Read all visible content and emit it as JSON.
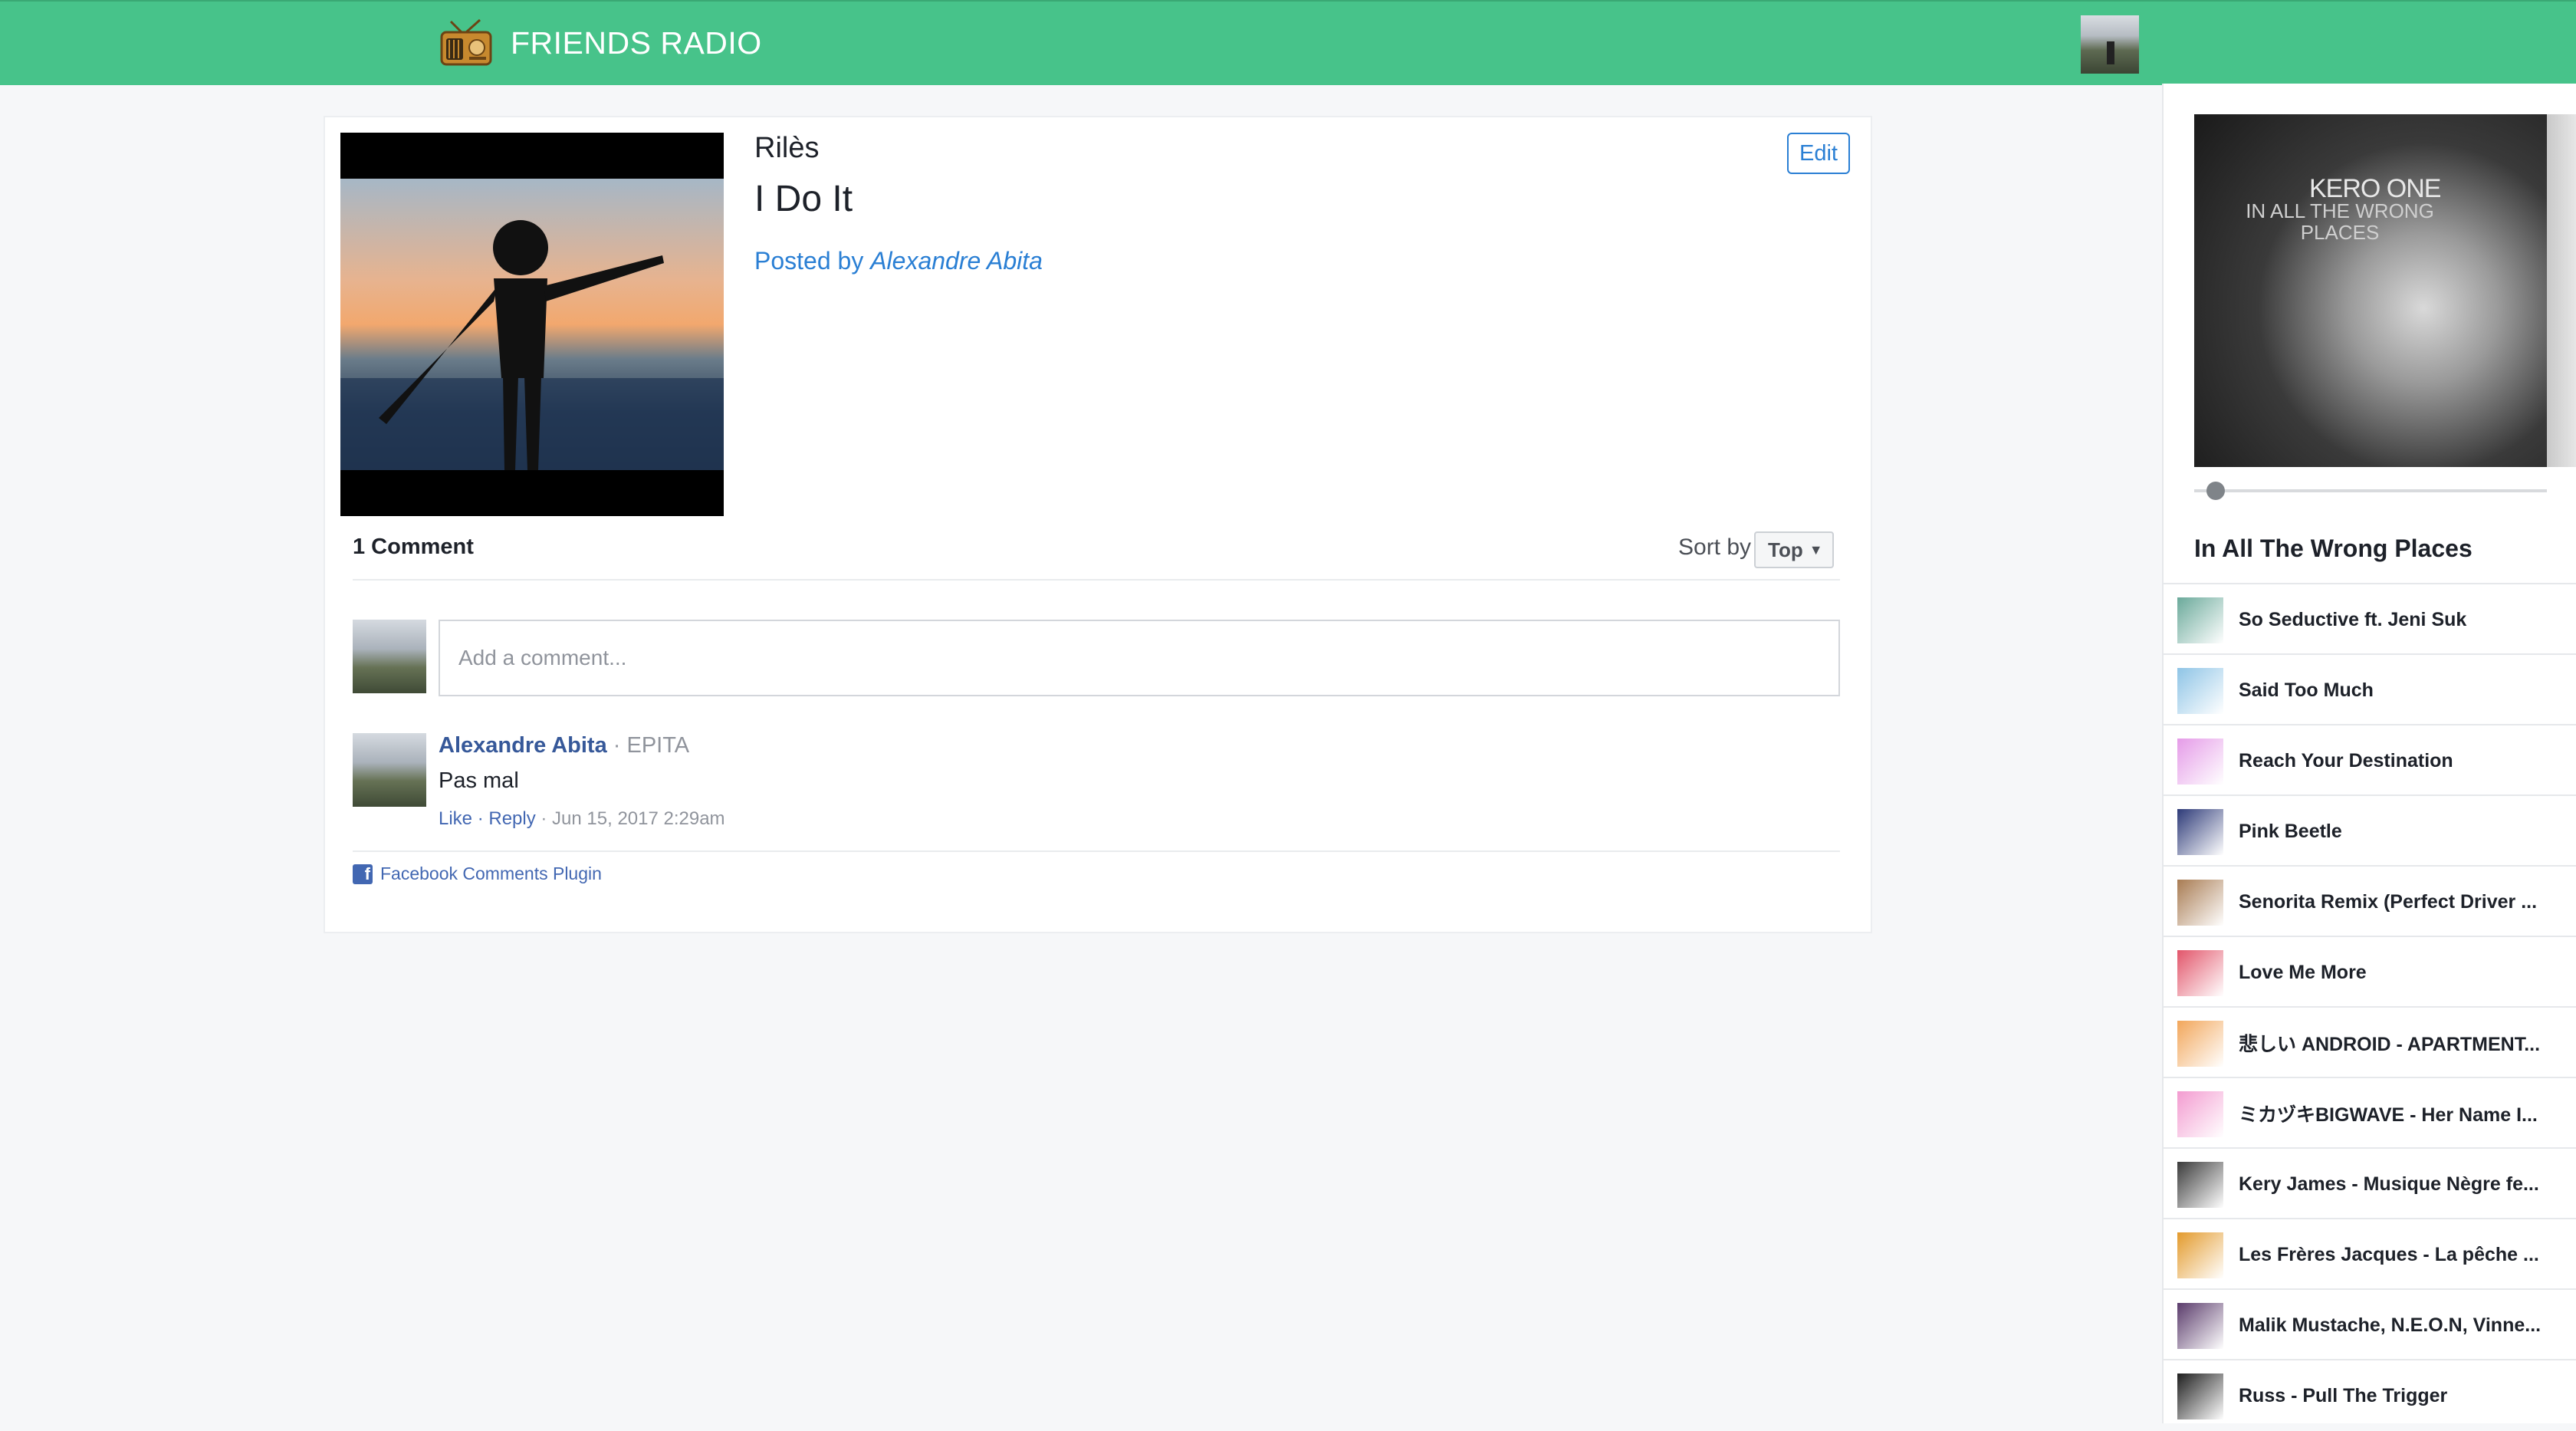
{
  "header": {
    "brand_title": "FRIENDS RADIO",
    "brand_icon": "radio-icon",
    "accent_color": "#47c38a"
  },
  "post": {
    "artist": "Rilès",
    "song": "I Do It",
    "posted_prefix": "Posted by",
    "posted_by": "Alexandre Abita",
    "edit_label": "Edit"
  },
  "comments": {
    "count_label": "1 Comment",
    "sort_label": "Sort by",
    "sort_value": "Top",
    "input_placeholder": "Add a comment...",
    "items": [
      {
        "author": "Alexandre Abita",
        "org": " · EPITA",
        "text": "Pas mal",
        "like": "Like",
        "sep1": " · ",
        "reply": "Reply",
        "timestamp": " · Jun 15, 2017 2:29am"
      }
    ],
    "plugin_label": "Facebook Comments Plugin"
  },
  "player": {
    "album_artist": "KERO ONE",
    "album_subtitle": "IN ALL THE WRONG PLACES",
    "now_playing": "In All The Wrong Places",
    "progress": 0.06
  },
  "playlist": [
    {
      "title": "So Seductive ft. Jeni Suk",
      "color": "#6aa99a"
    },
    {
      "title": "Said Too Much",
      "color": "#8ec4e6"
    },
    {
      "title": "Reach Your Destination",
      "color": "#e59be8"
    },
    {
      "title": "Pink Beetle",
      "color": "#2d3a78"
    },
    {
      "title": "Senorita Remix (Perfect Driver ...",
      "color": "#a87b52"
    },
    {
      "title": "Love Me More",
      "color": "#e2556a"
    },
    {
      "title": "悲しい ANDROID - APARTMENT...",
      "color": "#f2a65a"
    },
    {
      "title": "ミカヅキBIGWAVE - Her Name I...",
      "color": "#f39bd0"
    },
    {
      "title": "Kery James - Musique Nègre fe...",
      "color": "#3a3a3a"
    },
    {
      "title": "Les Frères Jacques - La pêche ...",
      "color": "#e39a2c"
    },
    {
      "title": "Malik Mustache, N.E.O.N, Vinne...",
      "color": "#5a3b6b"
    },
    {
      "title": "Russ - Pull The Trigger",
      "color": "#1e1e1e"
    }
  ]
}
